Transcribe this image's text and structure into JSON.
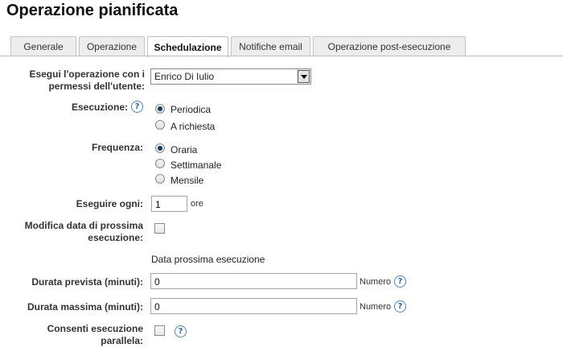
{
  "page": {
    "title": "Operazione pianificata"
  },
  "tabs": [
    {
      "label": "Generale"
    },
    {
      "label": "Operazione"
    },
    {
      "label": "Schedulazione"
    },
    {
      "label": "Notifiche email"
    },
    {
      "label": "Operazione post-esecuzione"
    }
  ],
  "active_tab": "Schedulazione",
  "form": {
    "run_as": {
      "label": "Esegui l'operazione con i permessi dell'utente:",
      "value": "Enrico Di Iulio"
    },
    "execution": {
      "label": "Esecuzione:",
      "help_icon": "?",
      "options": [
        {
          "label": "Periodica",
          "selected": true
        },
        {
          "label": "A richiesta",
          "selected": false
        }
      ]
    },
    "frequency": {
      "label": "Frequenza:",
      "options": [
        {
          "label": "Oraria",
          "selected": true
        },
        {
          "label": "Settimanale",
          "selected": false
        },
        {
          "label": "Mensile",
          "selected": false
        }
      ]
    },
    "every": {
      "label": "Eseguire ogni:",
      "value": "1",
      "unit": "ore"
    },
    "modify_next": {
      "label": "Modifica data di prossima esecuzione:",
      "checked": false
    },
    "next_run_caption": "Data prossima esecuzione",
    "expected_duration": {
      "label": "Durata prevista (minuti):",
      "value": "0",
      "hint": "Numero",
      "help_icon": "?"
    },
    "max_duration": {
      "label": "Durata massima (minuti):",
      "value": "0",
      "hint": "Numero",
      "help_icon": "?"
    },
    "parallel": {
      "label": "Consenti esecuzione parallela:",
      "checked": false,
      "help_icon": "?"
    }
  }
}
